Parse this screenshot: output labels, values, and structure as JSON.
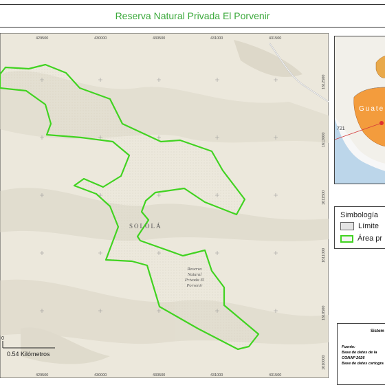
{
  "title": "Reserva Natural Privada El Porvenir",
  "map": {
    "region_label": "SOLOLÁ",
    "area_label_lines": [
      "Reserva",
      "Natural",
      "Privada El",
      "Porvenir"
    ],
    "x_ticks": [
      "429500",
      "430000",
      "430500",
      "431000",
      "431500"
    ],
    "y_ticks": [
      "1612500",
      "1612000",
      "1611500",
      "1611000",
      "1610500",
      "1610000"
    ],
    "scale_label": "0.54 Kilómetros",
    "scale_zero": "0",
    "colors": {
      "boundary": "#41d321",
      "terrain": "#e8e4d8",
      "relief": "#d6d2c4"
    }
  },
  "inset": {
    "label": "Guate",
    "number_label": "721"
  },
  "legend": {
    "title": "Simbología",
    "items": [
      {
        "label": "Límite",
        "swatch": "gray"
      },
      {
        "label": "Área pr",
        "swatch": "green"
      }
    ]
  },
  "info": {
    "sistema": "Sistem",
    "fuente_lines": [
      "Fuente:",
      "Base de datos de la",
      "CONAP 2026",
      "Base de datos cartogra"
    ]
  }
}
